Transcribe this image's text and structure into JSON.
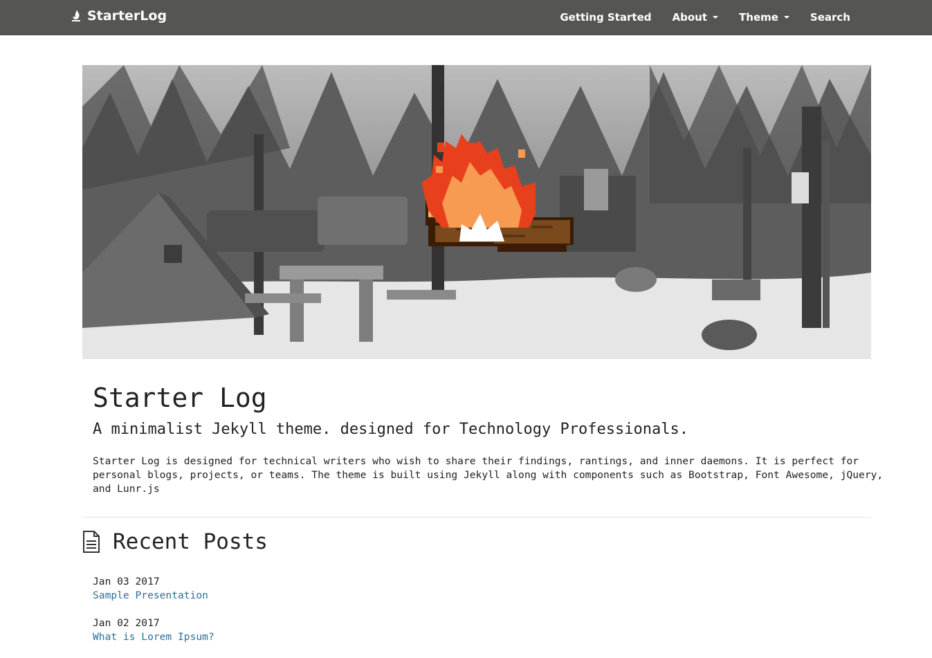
{
  "navbar": {
    "brand": "StarterLog",
    "items": [
      {
        "label": "Getting Started",
        "dropdown": false
      },
      {
        "label": "About",
        "dropdown": true
      },
      {
        "label": "Theme",
        "dropdown": true
      },
      {
        "label": "Search",
        "dropdown": false
      }
    ]
  },
  "intro": {
    "title": "Starter Log",
    "tagline": "A minimalist Jekyll theme. designed for Technology Professionals.",
    "description": "Starter Log is designed for technical writers who wish to share their findings, rantings, and inner daemons. It is perfect for personal blogs, projects, or teams. The theme is built using Jekyll along with components such as Bootstrap, Font Awesome, jQuery, and Lunr.js"
  },
  "recent": {
    "heading": "Recent Posts",
    "posts": [
      {
        "date": "Jan 03 2017",
        "title": "Sample Presentation"
      },
      {
        "date": "Jan 02 2017",
        "title": "What is Lorem Ipsum?"
      }
    ]
  },
  "colors": {
    "navbar_bg": "#555553",
    "link": "#2a6f9a",
    "fire_red": "#e8401c",
    "fire_orange": "#f79a52",
    "log_brown": "#7a4a1c"
  },
  "icons": {
    "brand": "flame-icon",
    "heading": "file-text-icon"
  }
}
